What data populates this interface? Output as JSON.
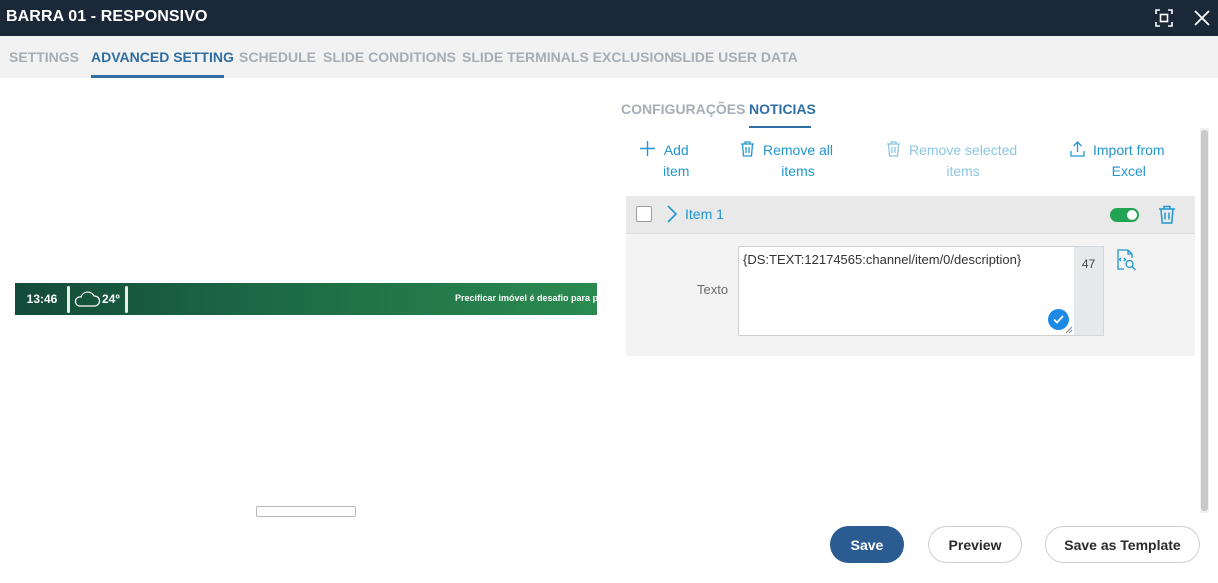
{
  "window": {
    "title": "BARRA 01 - RESPONSIVO"
  },
  "tabs": [
    {
      "label": "SETTINGS",
      "active": false
    },
    {
      "label": "ADVANCED SETTING",
      "active": true
    },
    {
      "label": "SCHEDULE",
      "active": false
    },
    {
      "label": "SLIDE CONDITIONS",
      "active": false
    },
    {
      "label": "SLIDE TERMINALS EXCLUSION",
      "active": false
    },
    {
      "label": "SLIDE USER DATA",
      "active": false
    }
  ],
  "preview": {
    "time": "13:46",
    "temperature": "24º",
    "ticker": "Precificar imóvel é desafio para p"
  },
  "subtabs": [
    {
      "label": "CONFIGURAÇÕES",
      "active": false
    },
    {
      "label": "NOTICIAS",
      "active": true
    }
  ],
  "actions": {
    "add_line1": "Add",
    "add_line2": "item",
    "remove_all_line1": "Remove all",
    "remove_all_line2": "items",
    "remove_selected_line1": "Remove selected",
    "remove_selected_line2": "items",
    "import_line1": "Import from",
    "import_line2": "Excel"
  },
  "item": {
    "title": "Item 1",
    "enabled": true,
    "field_label": "Texto",
    "text_value": "{DS:TEXT:12174565:channel/item/0/description}",
    "char_count": "47"
  },
  "footer": {
    "save": "Save",
    "preview": "Preview",
    "save_template": "Save as Template"
  },
  "colors": {
    "titlebar": "#1b2838",
    "accent": "#2e6ea3",
    "link": "#2196d0",
    "toggle_on": "#23a455",
    "primary_button": "#2b5c91"
  }
}
